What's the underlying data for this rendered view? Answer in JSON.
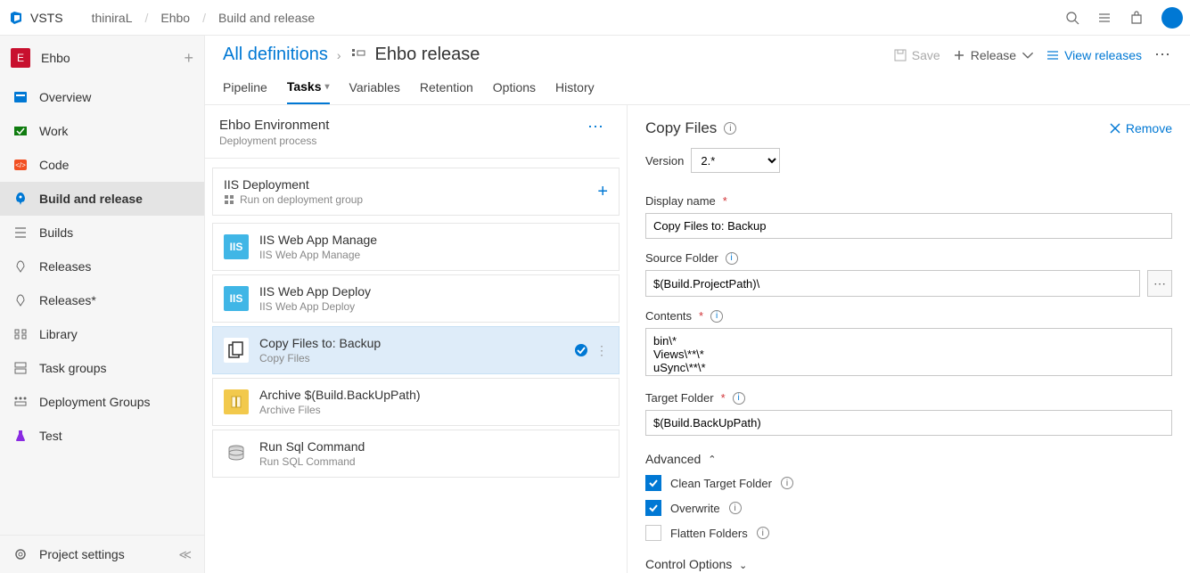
{
  "brand": "VSTS",
  "breadcrumb": [
    "thiniraL",
    "Ehbo",
    "Build and release"
  ],
  "project": {
    "badge": "E",
    "name": "Ehbo"
  },
  "sidebar": {
    "items": [
      {
        "icon": "overview",
        "label": "Overview"
      },
      {
        "icon": "work",
        "label": "Work"
      },
      {
        "icon": "code",
        "label": "Code"
      },
      {
        "icon": "rocket",
        "label": "Build and release"
      },
      {
        "icon": "builds",
        "label": "Builds"
      },
      {
        "icon": "releases",
        "label": "Releases"
      },
      {
        "icon": "releases",
        "label": "Releases*"
      },
      {
        "icon": "library",
        "label": "Library"
      },
      {
        "icon": "taskgroups",
        "label": "Task groups"
      },
      {
        "icon": "deploygroups",
        "label": "Deployment Groups"
      },
      {
        "icon": "test",
        "label": "Test"
      }
    ],
    "bottom": {
      "label": "Project settings"
    }
  },
  "header": {
    "all_definitions": "All definitions",
    "title": "Ehbo release",
    "actions": {
      "save": "Save",
      "release": "Release",
      "view_releases": "View releases"
    }
  },
  "tabs": [
    "Pipeline",
    "Tasks",
    "Variables",
    "Retention",
    "Options",
    "History"
  ],
  "active_tab": "Tasks",
  "environment": {
    "name": "Ehbo Environment",
    "sub": "Deployment process"
  },
  "phase": {
    "name": "IIS Deployment",
    "sub": "Run on deployment group"
  },
  "tasks": [
    {
      "icon": "iis",
      "title": "IIS Web App Manage",
      "sub": "IIS Web App Manage"
    },
    {
      "icon": "iis",
      "title": "IIS Web App Deploy",
      "sub": "IIS Web App Deploy"
    },
    {
      "icon": "copy",
      "title": "Copy Files to: Backup",
      "sub": "Copy Files",
      "selected": true
    },
    {
      "icon": "archive",
      "title": "Archive $(Build.BackUpPath)",
      "sub": "Archive Files"
    },
    {
      "icon": "sql",
      "title": "Run Sql Command",
      "sub": "Run SQL Command"
    }
  ],
  "props": {
    "title": "Copy Files",
    "remove": "Remove",
    "version_label": "Version",
    "version": "2.*",
    "display_name_label": "Display name",
    "display_name": "Copy Files to: Backup",
    "source_label": "Source Folder",
    "source": "$(Build.ProjectPath)\\",
    "contents_label": "Contents",
    "contents": "bin\\*\nViews\\**\\*\nuSync\\**\\*",
    "target_label": "Target Folder",
    "target": "$(Build.BackUpPath)",
    "advanced": "Advanced",
    "clean_target": "Clean Target Folder",
    "overwrite": "Overwrite",
    "flatten": "Flatten Folders",
    "control_options": "Control Options"
  }
}
